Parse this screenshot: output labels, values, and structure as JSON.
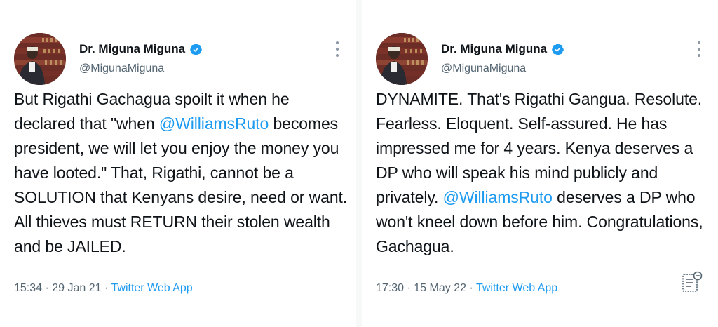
{
  "tweets": [
    {
      "author": {
        "name": "Dr. Miguna Miguna",
        "handle": "@MigunaMiguna",
        "verified_icon": "verified-badge-icon"
      },
      "body": [
        {
          "text": "But Rigathi Gachagua spoilt it when he declared that \"when "
        },
        {
          "text": "@WilliamsRuto",
          "mention": true
        },
        {
          "text": " becomes president, we will let you enjoy the money you have looted.\" That, Rigathi, cannot be a SOLUTION that Kenyans desire, need or want. All thieves must RETURN their stolen wealth and be JAILED."
        }
      ],
      "time": "15:34",
      "date": "29 Jan 21",
      "separator": "·",
      "source": "Twitter Web App"
    },
    {
      "author": {
        "name": "Dr. Miguna Miguna",
        "handle": "@MigunaMiguna",
        "verified_icon": "verified-badge-icon"
      },
      "body": [
        {
          "text": "DYNAMITE. That's Rigathi Gangua. Resolute. Fearless. Eloquent. Self-assured. He has impressed me for 4 years. Kenya deserves a DP who will speak his mind publicly and privately. "
        },
        {
          "text": "@WilliamsRuto",
          "mention": true
        },
        {
          "text": " deserves a DP who won't kneel down before him. Congratulations, Gachagua."
        }
      ],
      "time": "17:30",
      "date": "15 May 22",
      "separator": "·",
      "source": "Twitter Web App"
    }
  ],
  "colors": {
    "accent": "#1d9bf0",
    "text": "#0f1419",
    "muted": "#536471"
  }
}
